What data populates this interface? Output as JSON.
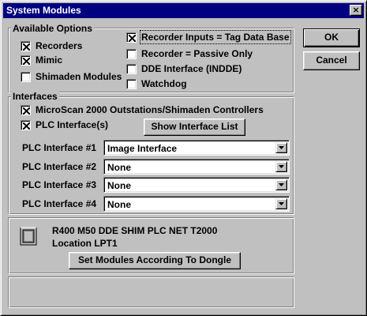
{
  "window": {
    "title": "System Modules",
    "close_glyph": "×"
  },
  "available_options": {
    "legend": "Available Options",
    "left": [
      {
        "label": "Recorders",
        "checked": true
      },
      {
        "label": "Mimic",
        "checked": true
      },
      {
        "label": "Shimaden Modules",
        "checked": false
      }
    ],
    "right": [
      {
        "label": "Recorder Inputs = Tag Data Base",
        "checked": true
      },
      {
        "label": "Recorder = Passive Only",
        "checked": false
      },
      {
        "label": "DDE Interface (INDDE)",
        "checked": false
      },
      {
        "label": "Watchdog",
        "checked": false
      }
    ]
  },
  "buttons": {
    "ok": "OK",
    "cancel": "Cancel",
    "show_interface_list": "Show Interface List",
    "set_modules": "Set Modules According To Dongle"
  },
  "interfaces": {
    "legend": "Interfaces",
    "microscan": {
      "label": "MicroScan 2000 Outstations/Shimaden Controllers",
      "checked": true
    },
    "plc": {
      "label": "PLC Interface(s)",
      "checked": true
    },
    "plc_rows": [
      {
        "label": "PLC Interface #1",
        "value": "Image Interface"
      },
      {
        "label": "PLC Interface #2",
        "value": "None"
      },
      {
        "label": "PLC Interface #3",
        "value": "None"
      },
      {
        "label": "PLC Interface #4",
        "value": "None"
      }
    ]
  },
  "dongle": {
    "icon": "dongle-icon",
    "modules_line": "R400 M50 DDE SHIM PLC NET T2000",
    "location_line": "Location LPT1"
  },
  "colors": {
    "titlebar": "#000080",
    "face": "#c0c0c0"
  }
}
